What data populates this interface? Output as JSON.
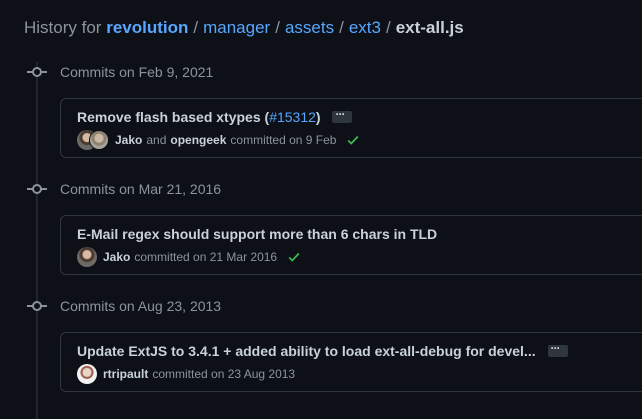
{
  "breadcrumb": {
    "prefix": "History for",
    "repo": "revolution",
    "segments": [
      "manager",
      "assets",
      "ext3"
    ],
    "separator": "/",
    "file": "ext-all.js"
  },
  "groups": [
    {
      "date_label": "Commits on Feb 9, 2021",
      "commit": {
        "title_text": "Remove flash based xtypes (",
        "pr_number": "#15312",
        "title_suffix": ")",
        "authors": [
          "Jako",
          "opengeek"
        ],
        "and_word": "and",
        "committed_text": "committed on 9 Feb",
        "status": "success"
      }
    },
    {
      "date_label": "Commits on Mar 21, 2016",
      "commit": {
        "title_text": "E-Mail regex should support more than 6 chars in TLD",
        "authors": [
          "Jako"
        ],
        "committed_text": "committed on 21 Mar 2016",
        "status": "success"
      }
    },
    {
      "date_label": "Commits on Aug 23, 2013",
      "commit": {
        "title_text": "Update ExtJS to 3.4.1 + added ability to load ext-all-debug for devel...",
        "authors": [
          "rtripault"
        ],
        "committed_text": "committed on 23 Aug 2013"
      }
    }
  ],
  "colors": {
    "background": "#0d1117",
    "link": "#58a6ff",
    "success": "#3fb950",
    "muted": "#8b949e"
  }
}
